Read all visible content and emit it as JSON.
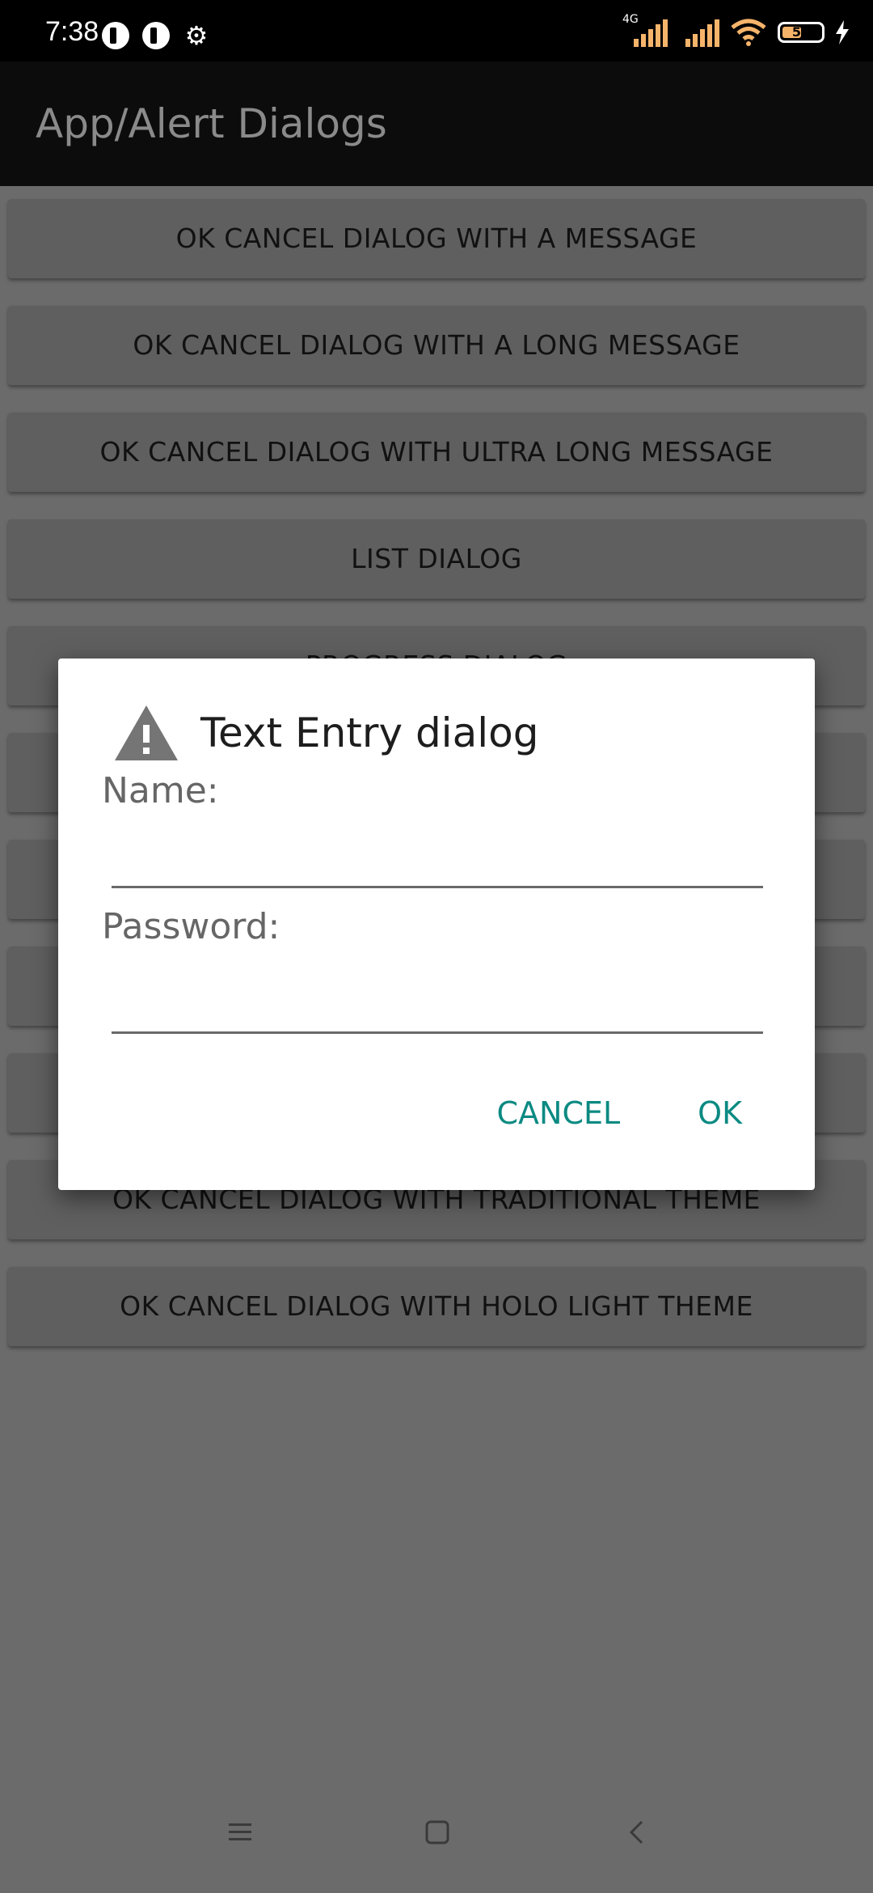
{
  "status_bar": {
    "time": "7:38",
    "network": "4G",
    "battery_level": "51",
    "battery_percent": 51
  },
  "app_bar": {
    "title": "App/Alert Dialogs"
  },
  "buttons": [
    "OK CANCEL DIALOG WITH A MESSAGE",
    "OK CANCEL DIALOG WITH A LONG MESSAGE",
    "OK CANCEL DIALOG WITH ULTRA LONG MESSAGE",
    "LIST DIALOG",
    "PROGRESS DIALOG",
    "",
    "",
    "",
    "",
    "OK CANCEL DIALOG WITH TRADITIONAL THEME",
    "OK CANCEL DIALOG WITH HOLO LIGHT THEME"
  ],
  "dialog": {
    "title": "Text Entry dialog",
    "name_label": "Name:",
    "name_value": "",
    "password_label": "Password:",
    "password_value": "",
    "cancel_label": "CANCEL",
    "ok_label": "OK"
  },
  "colors": {
    "accent": "#0b8a82",
    "scrim_background": "#6b6b6b",
    "app_bar": "#0c0c0c",
    "status_bar": "#000000"
  },
  "icons": {
    "status": [
      "app-notification-icon",
      "app-notification-icon",
      "gear-icon",
      "signal-icon",
      "signal-icon",
      "wifi-icon",
      "battery-icon",
      "charging-icon"
    ],
    "dialog": "warning-icon",
    "nav": [
      "menu-icon",
      "home-icon",
      "back-icon"
    ]
  }
}
